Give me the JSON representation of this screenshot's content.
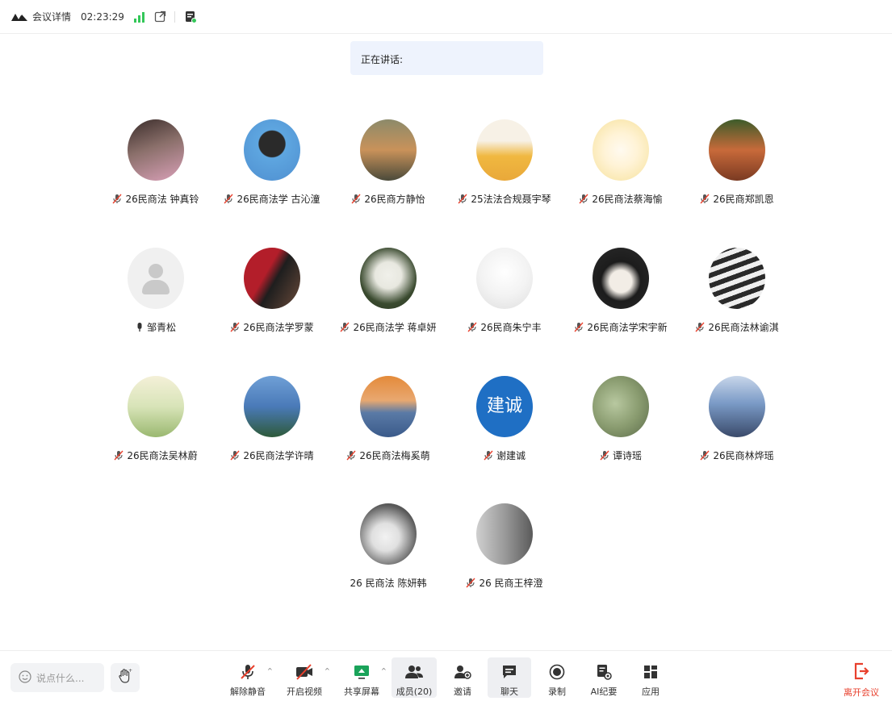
{
  "topbar": {
    "title": "会议详情",
    "elapsed_time": "02:23:29"
  },
  "speaking": {
    "label": "正在讲话:"
  },
  "participants": [
    {
      "name": "26民商法 钟真铃",
      "muted": true,
      "avatar_color": "#8a6f6a"
    },
    {
      "name": "26民商法学 古沁潼",
      "muted": true,
      "avatar_color": "#4f8fd0"
    },
    {
      "name": "26民商方静怡",
      "muted": true,
      "avatar_color": "#6a6a52"
    },
    {
      "name": "25法法合规聂宇琴",
      "muted": true,
      "avatar_color": "#e6b54a"
    },
    {
      "name": "26民商法蔡海愉",
      "muted": true,
      "avatar_color": "#f5e3a8"
    },
    {
      "name": "26民商郑凯恩",
      "muted": true,
      "avatar_color": "#a0522d"
    },
    {
      "name": "邹青松",
      "muted": false,
      "avatar_color": "#f0f0f0"
    },
    {
      "name": "26民商法学罗蒙",
      "muted": true,
      "avatar_color": "#8c1c24"
    },
    {
      "name": "26民商法学 蒋卓妍",
      "muted": true,
      "avatar_color": "#4d5a3f"
    },
    {
      "name": "26民商朱宁丰",
      "muted": true,
      "avatar_color": "#e9e9e9"
    },
    {
      "name": "26民商法学宋宇新",
      "muted": true,
      "avatar_color": "#2b2b2b"
    },
    {
      "name": "26民商法林谕淇",
      "muted": true,
      "avatar_color": "#5c4a3f"
    },
    {
      "name": "26民商法吴林蔚",
      "muted": true,
      "avatar_color": "#c9d8a8"
    },
    {
      "name": "26民商法学许晴",
      "muted": true,
      "avatar_color": "#3d6ea8"
    },
    {
      "name": "26民商法梅奚萌",
      "muted": true,
      "avatar_color": "#d98c4a"
    },
    {
      "name": "谢建诚",
      "muted": true,
      "avatar_color": "#1f6fc4",
      "avatar_text": "建诚"
    },
    {
      "name": "谭诗瑶",
      "muted": true,
      "avatar_color": "#7d8e67"
    },
    {
      "name": "26民商林烨瑶",
      "muted": true,
      "avatar_color": "#4a6fa0"
    },
    {
      "name": "26 民商法 陈妍韩",
      "muted": false,
      "avatar_color": "#6f6f6f"
    },
    {
      "name": "26 民商王梓澄",
      "muted": true,
      "avatar_color": "#8a8a8a"
    }
  ],
  "chat": {
    "placeholder": "说点什么..."
  },
  "toolbar": {
    "unmute": "解除静音",
    "start_video": "开启视频",
    "share_screen": "共享屏幕",
    "members": "成员(20)",
    "invite": "邀请",
    "chat": "聊天",
    "record": "录制",
    "ai_summary": "AI纪要",
    "apps": "应用",
    "leave": "离开会议"
  },
  "colors": {
    "leave": "#e8402d",
    "signal": "#34c759",
    "speaking_bg": "#eef3fd",
    "muted_mic": "#e8402d"
  }
}
